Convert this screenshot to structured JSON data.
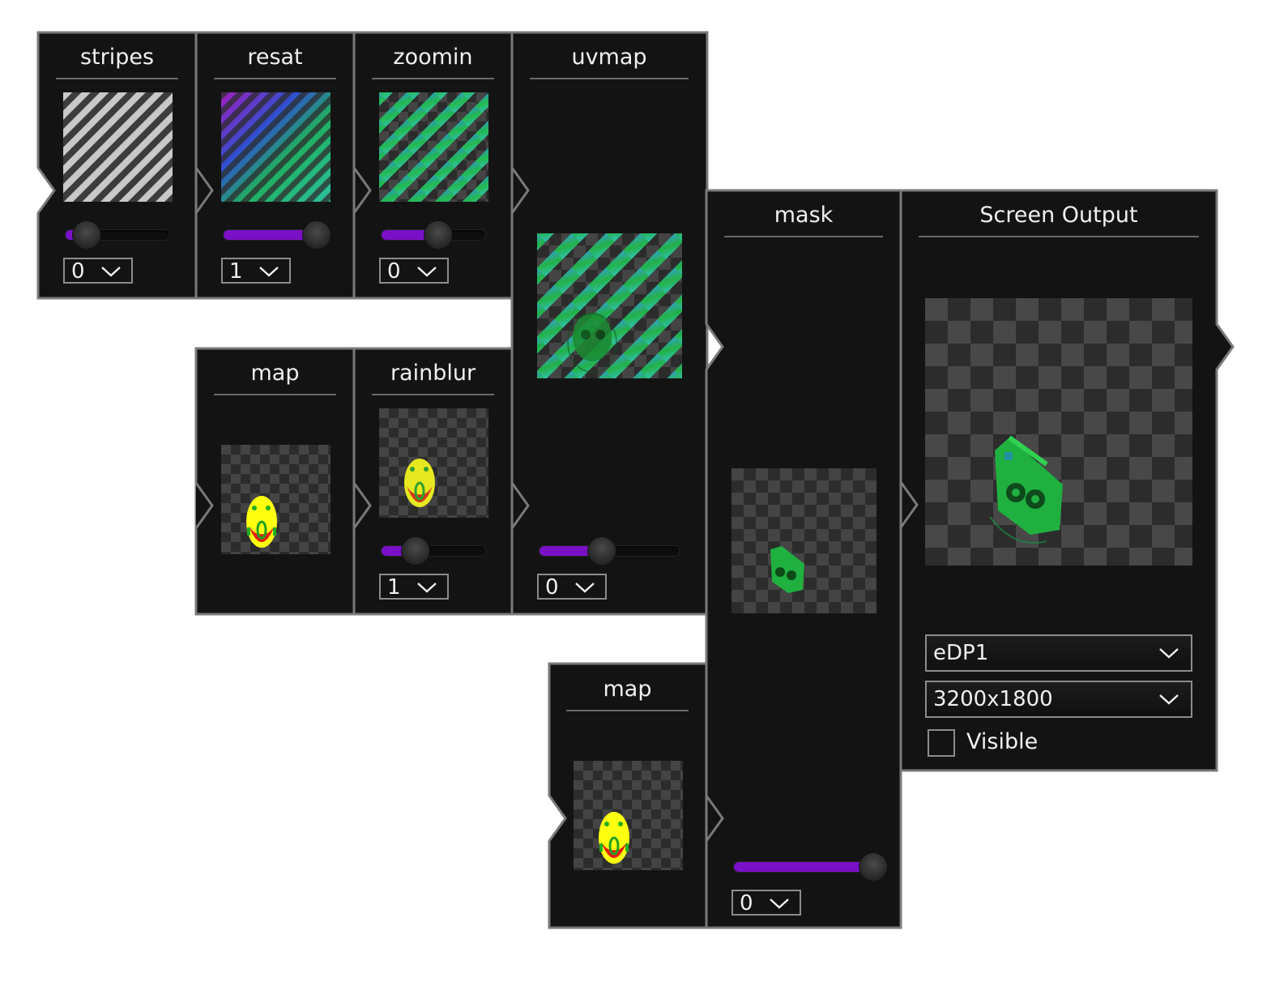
{
  "colors": {
    "panel": "#121212",
    "border": "#7a7a7a",
    "accent": "#7a10c8",
    "text": "#f0f0f0"
  },
  "nodes": {
    "stripes": {
      "title": "stripes",
      "combo_value": "0",
      "slider_fraction": 0.2
    },
    "resat": {
      "title": "resat",
      "combo_value": "1",
      "slider_fraction": 0.9
    },
    "zoomin": {
      "title": "zoomin",
      "combo_value": "0",
      "slider_fraction": 0.55
    },
    "uvmap": {
      "title": "uvmap",
      "combo_value": "0",
      "slider_fraction": 0.45
    },
    "map1": {
      "title": "map"
    },
    "rainblur": {
      "title": "rainblur",
      "combo_value": "1",
      "slider_fraction": 0.33
    },
    "map2": {
      "title": "map"
    },
    "mask": {
      "title": "mask",
      "combo_value": "0",
      "slider_fraction": 1.0
    },
    "screen_output": {
      "title": "Screen Output",
      "display_value": "eDP1",
      "resolution_value": "3200x1800",
      "visible_label": "Visible",
      "visible_checked": false
    }
  },
  "icons": {
    "dropdown": "chevron-down-icon"
  }
}
